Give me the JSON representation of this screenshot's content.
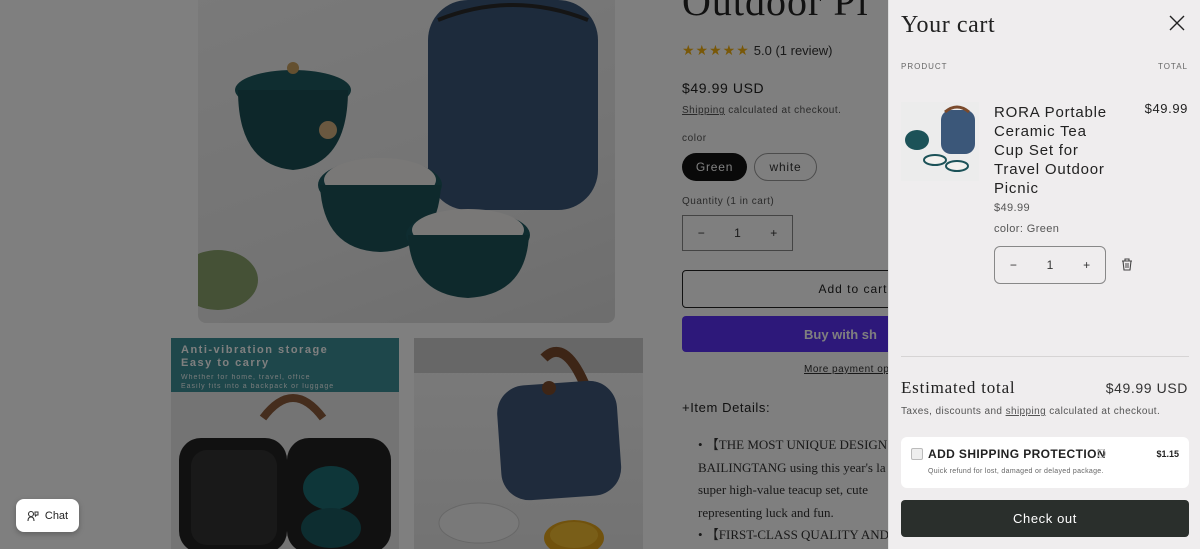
{
  "product": {
    "title": "Outdoor Pi",
    "stars": "★★★★★",
    "rating": "5.0 (1 review)",
    "price": "$49.99 USD",
    "shipping_link": "Shipping",
    "shipping_note": " calculated at checkout.",
    "color_label": "color",
    "color_options": [
      "Green",
      "white"
    ],
    "quantity_label": "Quantity (1 in cart)",
    "quantity_value": "1",
    "add_to_cart": "Add to cart",
    "buy_now": "Buy with sh",
    "more_payment": "More payment opti",
    "details_heading": "+Item Details:",
    "details_lines": [
      "•  【THE MOST UNIQUE DESIGN",
      "BAILINGTANG using this year's la",
      "super high-value teacup set, cute",
      "representing luck and fun.",
      "•  【FIRST-CLASS QUALITY AND"
    ],
    "thumb_banner": {
      "line1": "Anti-vibration storage",
      "line2": "Easy to carry",
      "line3": "Whether for home, travel, office",
      "line4": "Easily fits into a backpack or luggage"
    }
  },
  "chat": {
    "label": "Chat"
  },
  "cart": {
    "title": "Your cart",
    "col_product": "PRODUCT",
    "col_total": "TOTAL",
    "item": {
      "name": "RORA Portable Ceramic Tea Cup Set for Travel Outdoor Picnic",
      "total": "$49.99",
      "price": "$49.99",
      "variant": "color: Green",
      "quantity": "1"
    },
    "estimated_label": "Estimated total",
    "estimated_value": "$49.99 USD",
    "tax_prefix": "Taxes, discounts and ",
    "tax_link": "shipping",
    "tax_suffix": " calculated at checkout.",
    "protection": {
      "title": "ADD SHIPPING PROTECTION",
      "amount": "$1.15",
      "subtitle": "Quick refund for lost, damaged or delayed package."
    },
    "checkout": "Check out"
  },
  "colors": {
    "overlay": "#000000",
    "buy_button": "#5a31f4",
    "checkout_button": "#2a2f2c",
    "star": "#f2b010",
    "drawer_bg": "#efedee"
  }
}
